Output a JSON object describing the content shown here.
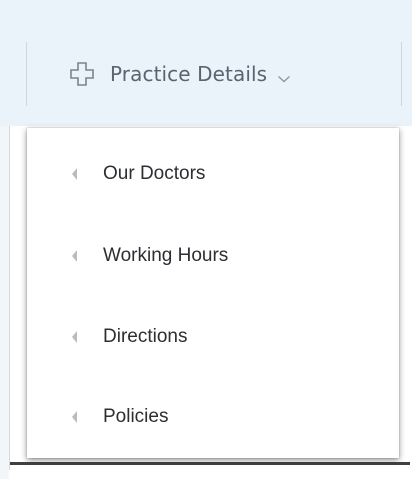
{
  "nav": {
    "icon": "cross-outline-icon",
    "label": "Practice Details",
    "chevron_icon": "chevron-down-icon"
  },
  "menu": {
    "items": [
      {
        "label": "Our Doctors",
        "icon": "caret-left-icon"
      },
      {
        "label": "Working Hours",
        "icon": "caret-left-icon"
      },
      {
        "label": "Directions",
        "icon": "caret-left-icon"
      },
      {
        "label": "Policies",
        "icon": "caret-left-icon"
      }
    ]
  },
  "colors": {
    "nav_background": "#eaf2fa",
    "nav_text": "#5a6470",
    "menu_text": "#2b2f33",
    "caret": "#b7bcc2"
  }
}
